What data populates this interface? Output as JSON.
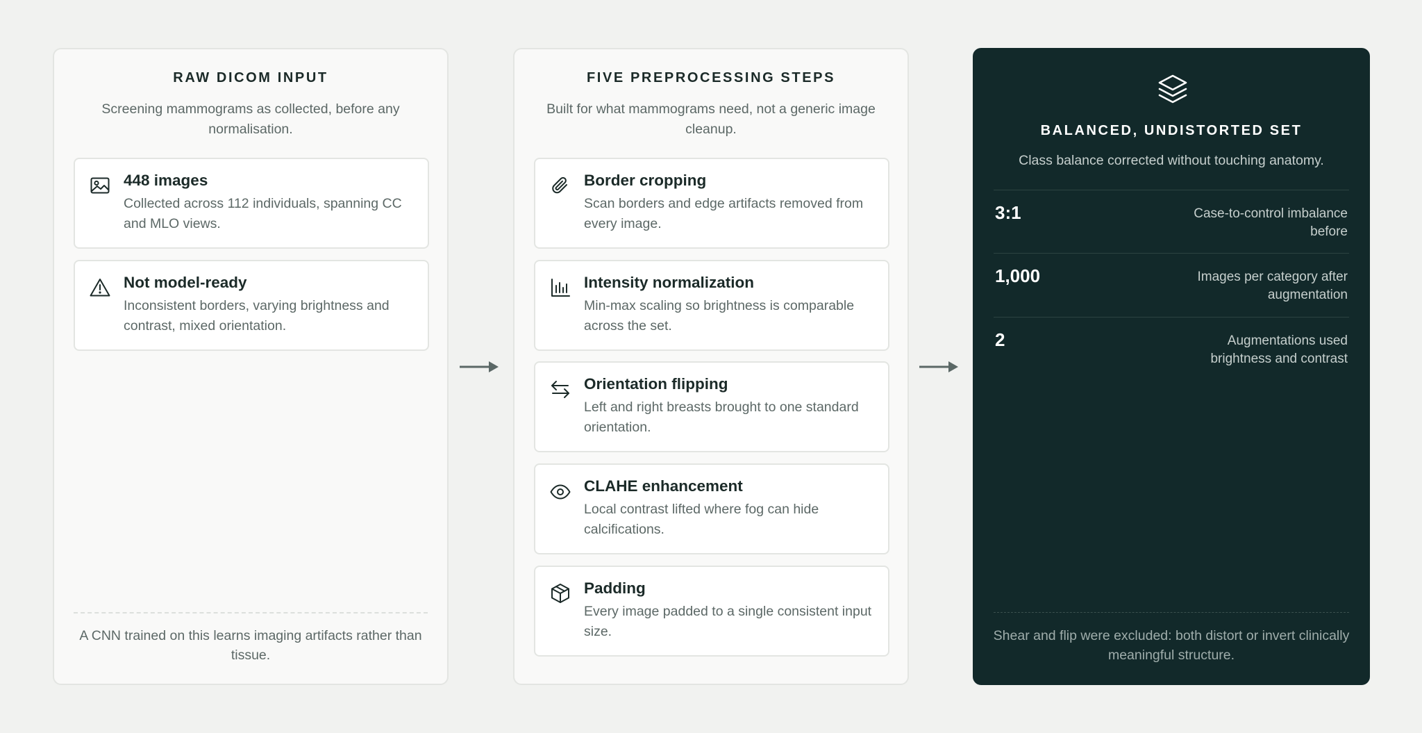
{
  "input_panel": {
    "title": "RAW DICOM INPUT",
    "subtitle": "Screening mammograms as collected, before any normalisation.",
    "cards": [
      {
        "icon": "image-icon",
        "title": "448 images",
        "text": "Collected across 112 individuals, spanning CC and MLO views."
      },
      {
        "icon": "warning-icon",
        "title": "Not model-ready",
        "text": "Inconsistent borders, varying brightness and contrast, mixed orientation."
      }
    ],
    "footer": "A CNN trained on this learns imaging artifacts rather than tissue."
  },
  "steps_panel": {
    "title": "FIVE PREPROCESSING STEPS",
    "subtitle": "Built for what mammograms need, not a generic image cleanup.",
    "steps": [
      {
        "icon": "paperclip-icon",
        "title": "Border cropping",
        "text": "Scan borders and edge artifacts removed from every image."
      },
      {
        "icon": "bar-chart-icon",
        "title": "Intensity normalization",
        "text": "Min-max scaling so brightness is comparable across the set."
      },
      {
        "icon": "swap-arrows-icon",
        "title": "Orientation flipping",
        "text": "Left and right breasts brought to one standard orientation."
      },
      {
        "icon": "eye-icon",
        "title": "CLAHE enhancement",
        "text": "Local contrast lifted where fog can hide calcifications."
      },
      {
        "icon": "box-icon",
        "title": "Padding",
        "text": "Every image padded to a single consistent input size."
      }
    ]
  },
  "output_panel": {
    "icon": "layers-icon",
    "title": "BALANCED, UNDISTORTED SET",
    "subtitle": "Class balance corrected without touching anatomy.",
    "stats": [
      {
        "value": "3:1",
        "label": "Case-to-control imbalance before"
      },
      {
        "value": "1,000",
        "label": "Images per category after augmentation"
      },
      {
        "value": "2",
        "label": "Augmentations used brightness and contrast"
      }
    ],
    "footer": "Shear and flip were excluded: both distort or invert clinically meaningful structure."
  },
  "colors": {
    "page_background": "#f1f2f0",
    "dark_panel": "#12292a",
    "arrow": "#5b6866",
    "heading_text": "#1b2a28",
    "muted_text": "#5c6866"
  }
}
